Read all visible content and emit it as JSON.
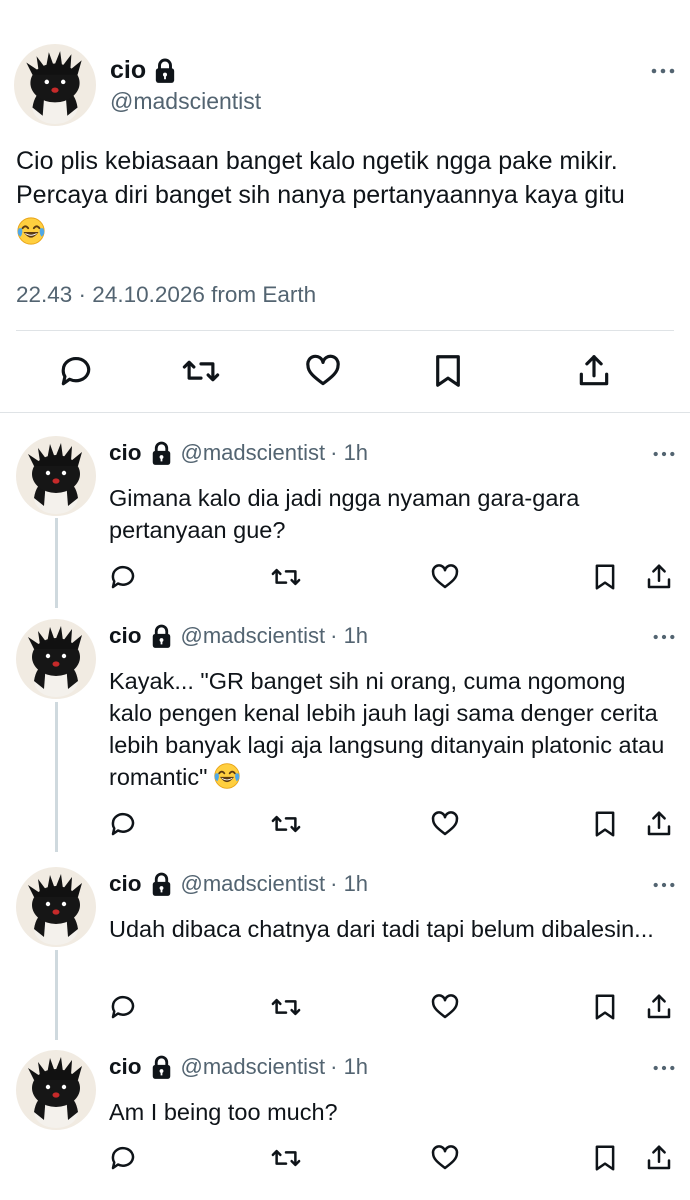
{
  "colors": {
    "text": "#0f1419",
    "muted": "#536471",
    "separator": "#dfe3e6",
    "thread_line": "#cfd9de"
  },
  "main_tweet": {
    "name": "cio",
    "handle": "@madscientist",
    "text": "Cio plis kebiasaan banget kalo ngetik ngga pake mikir. Percaya diri banget sih nanya pertanyaannya kaya gitu",
    "emoji": "face-with-tears-of-joy",
    "timestamp": "22.43 · 24.10.2026 from Earth",
    "lock_icon": "lock-icon",
    "actions": [
      "reply-icon",
      "retweet-icon",
      "like-icon",
      "bookmark-icon",
      "share-icon"
    ]
  },
  "replies": [
    {
      "name": "cio",
      "handle": "@madscientist",
      "time": "· 1h",
      "text": "Gimana kalo dia jadi ngga nyaman gara-gara pertanyaan gue?"
    },
    {
      "name": "cio",
      "handle": "@madscientist",
      "time": "· 1h",
      "text": "Kayak... \"GR banget sih ni orang, cuma ngomong kalo pengen kenal lebih jauh lagi sama denger cerita lebih banyak lagi aja langsung ditanyain platonic atau romantic\"",
      "emoji": "face-with-tears-of-joy"
    },
    {
      "name": "cio",
      "handle": "@madscientist",
      "time": "· 1h",
      "text": "Udah dibaca chatnya dari tadi tapi belum dibalesin..."
    },
    {
      "name": "cio",
      "handle": "@madscientist",
      "time": "· 1h",
      "text": "Am I being too much?"
    }
  ]
}
